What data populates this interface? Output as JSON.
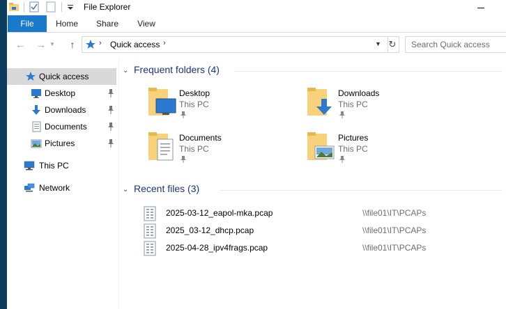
{
  "window": {
    "title": "File Explorer"
  },
  "ribbon": {
    "tabs": [
      "File",
      "Home",
      "Share",
      "View"
    ]
  },
  "address": {
    "path": "Quick access"
  },
  "search": {
    "placeholder": "Search Quick access"
  },
  "nav_pane": {
    "items": [
      {
        "label": "Quick access",
        "icon": "star-icon",
        "pinned": false,
        "selected": true
      },
      {
        "label": "Desktop",
        "icon": "desktop-icon",
        "pinned": true
      },
      {
        "label": "Downloads",
        "icon": "download-icon",
        "pinned": true
      },
      {
        "label": "Documents",
        "icon": "documents-icon",
        "pinned": true
      },
      {
        "label": "Pictures",
        "icon": "pictures-icon",
        "pinned": true
      },
      {
        "label": "This PC",
        "icon": "computer-icon",
        "pinned": false
      },
      {
        "label": "Network",
        "icon": "network-icon",
        "pinned": false
      }
    ]
  },
  "frequent_folders": {
    "title": "Frequent folders (4)",
    "items": [
      {
        "name": "Desktop",
        "location": "This PC"
      },
      {
        "name": "Downloads",
        "location": "This PC"
      },
      {
        "name": "Documents",
        "location": "This PC"
      },
      {
        "name": "Pictures",
        "location": "This PC"
      }
    ]
  },
  "recent_files": {
    "title": "Recent files (3)",
    "items": [
      {
        "name": "2025-03-12_eapol-mka.pcap",
        "path": "\\\\file01\\IT\\PCAPs"
      },
      {
        "name": "2025_03-12_dhcp.pcap",
        "path": "\\\\file01\\IT\\PCAPs"
      },
      {
        "name": "2025-04-28_ipv4frags.pcap",
        "path": "\\\\file01\\IT\\PCAPs"
      }
    ]
  },
  "colors": {
    "accent": "#1979ca",
    "group_title": "#1e3287",
    "folder": "#f7d27a",
    "selected": "#d9d9d9"
  }
}
